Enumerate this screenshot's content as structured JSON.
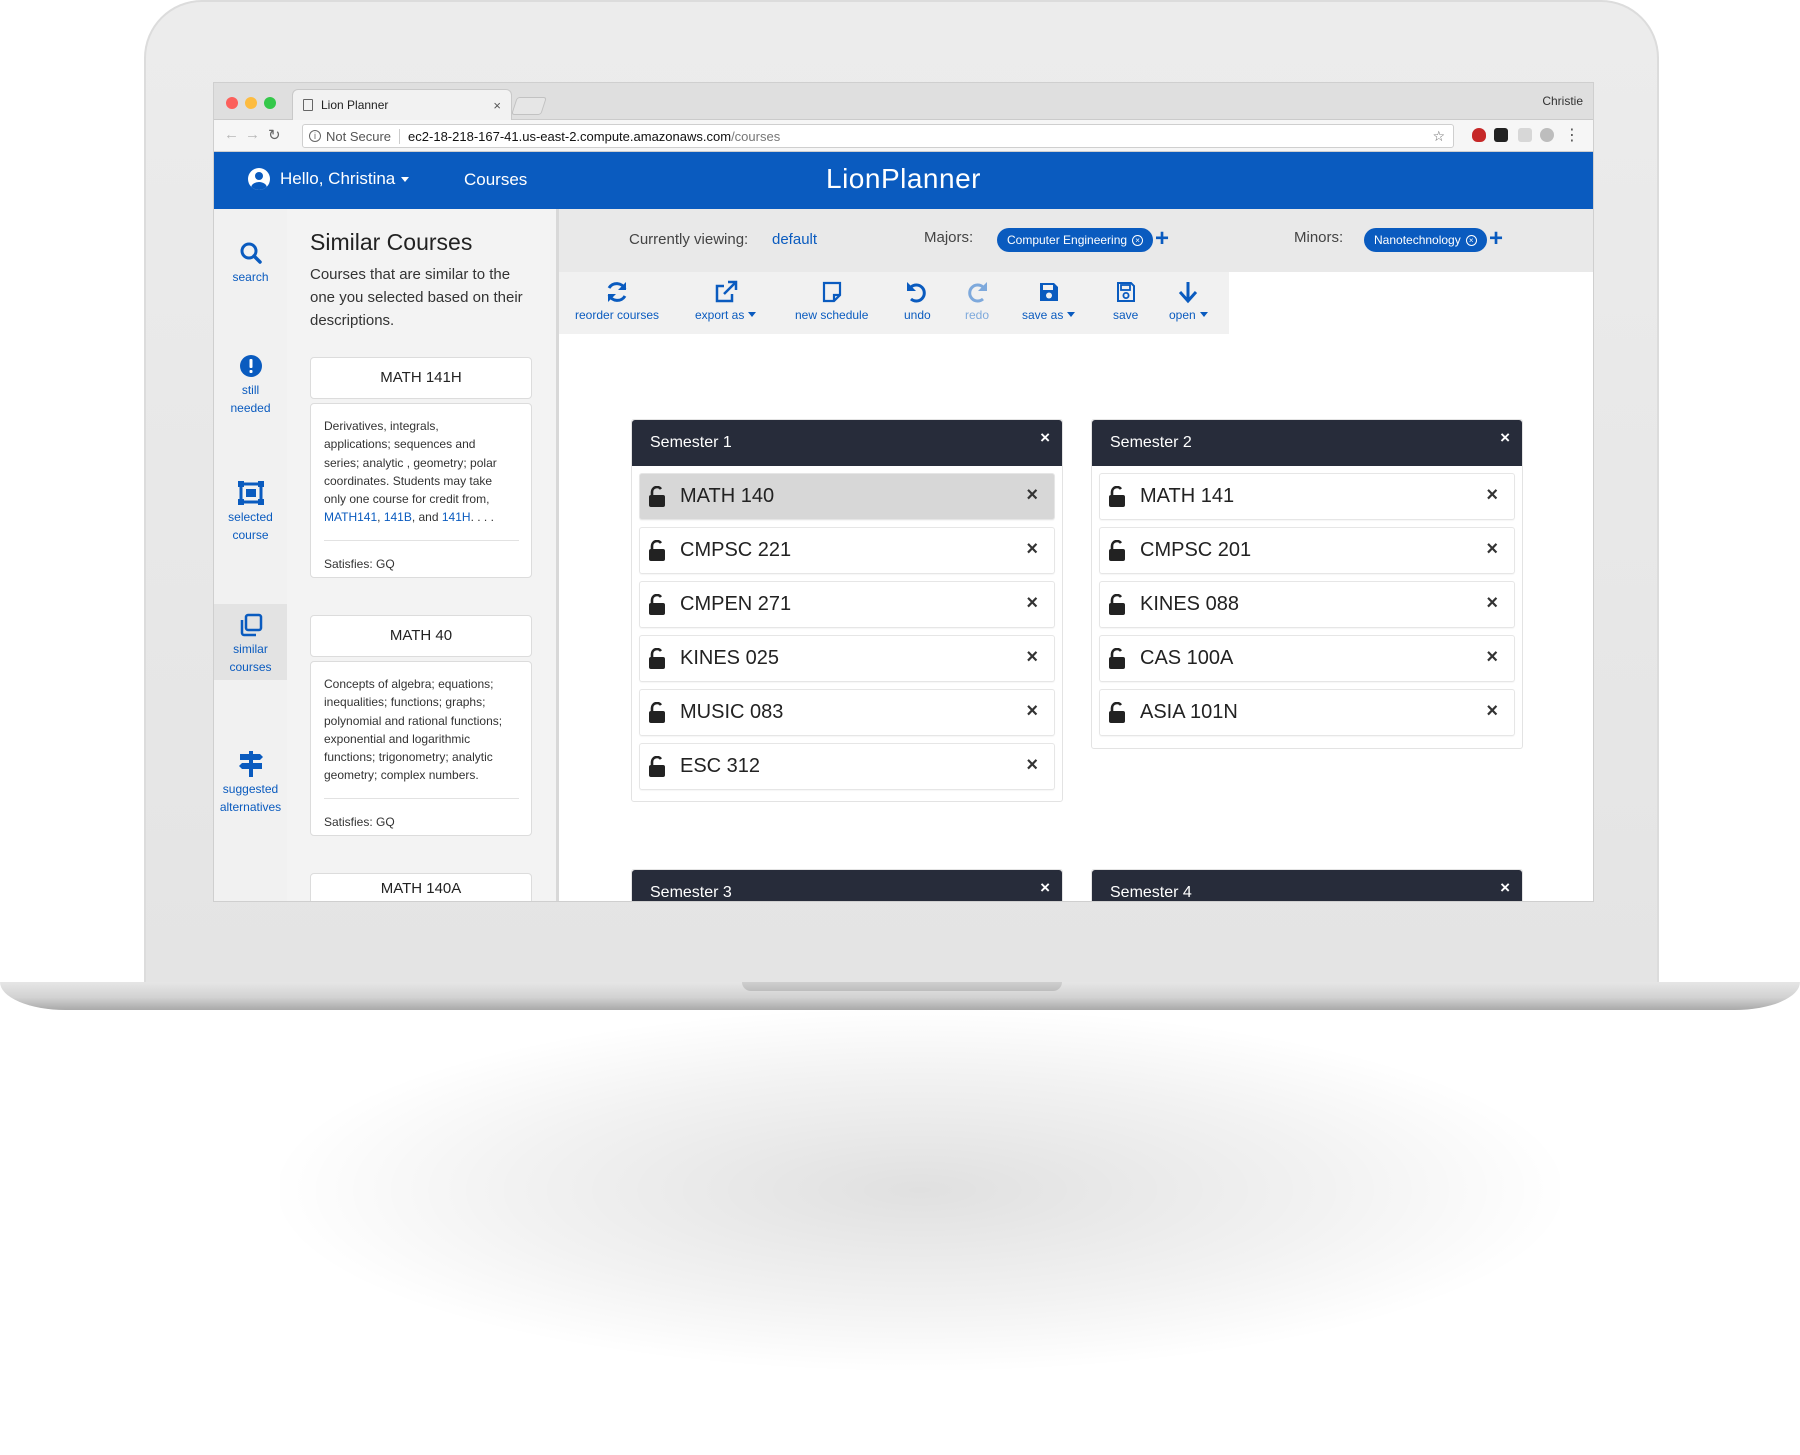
{
  "browser": {
    "tab_title": "Lion Planner",
    "tab_close": "×",
    "profile_name": "Christie",
    "security_label": "Not Secure",
    "url_host": "ec2-18-218-167-41.us-east-2.compute.amazonaws.com",
    "url_path": "/courses",
    "icons": [
      "back-arrow-icon",
      "forward-arrow-icon",
      "reload-icon",
      "info-icon",
      "star-icon",
      "menu-dots-icon"
    ]
  },
  "header": {
    "greeting": "Hello, Christina",
    "nav_courses": "Courses",
    "app_title": "LionPlanner",
    "brand_color": "#0a5bbf"
  },
  "rail": {
    "items": [
      {
        "label_line1": "search",
        "label_line2": "",
        "icon": "search-icon"
      },
      {
        "label_line1": "still",
        "label_line2": "needed",
        "icon": "exclamation-circle-icon"
      },
      {
        "label_line1": "selected",
        "label_line2": "course",
        "icon": "selected-course-icon"
      },
      {
        "label_line1": "similar",
        "label_line2": "courses",
        "icon": "copy-icon",
        "active": true
      },
      {
        "label_line1": "suggested",
        "label_line2": "alternatives",
        "icon": "signpost-icon"
      }
    ]
  },
  "similar_panel": {
    "title": "Similar Courses",
    "description": "Courses that are similar to the one you selected based on their descriptions.",
    "cards": [
      {
        "code": "MATH 141H",
        "desc_line1": "Derivatives, integrals,",
        "desc_line2": "applications; sequences and",
        "desc_line3": "series; analytic , geometry; polar",
        "desc_line4": "coordinates. Students may take",
        "desc_line5": "only one course for credit from,",
        "link1": "MATH141",
        "sep1": ", ",
        "link2": "141B",
        "sep2": ", and ",
        "link3": "141H",
        "ellipsis": ". . . .",
        "satisfies": "Satisfies:  GQ"
      },
      {
        "code": "MATH 40",
        "desc_line1": "Concepts of algebra; equations;",
        "desc_line2": "inequalities; functions; graphs;",
        "desc_line3": "polynomial and rational functions;",
        "desc_line4": "exponential and logarithmic",
        "desc_line5": "functions; trigonometry; analytic",
        "desc_line6": "geometry; complex numbers.",
        "satisfies": "Satisfies:  GQ"
      },
      {
        "code": "MATH 140A"
      }
    ]
  },
  "viewbar": {
    "viewing_label": "Currently viewing:",
    "viewing_value": "default",
    "majors_label": "Majors:",
    "major": "Computer Engineering",
    "minors_label": "Minors:",
    "minor": "Nanotechnology",
    "add_symbol": "+",
    "remove_symbol": "×"
  },
  "toolbar": {
    "reorder": "reorder courses",
    "export": "export as",
    "new_schedule": "new schedule",
    "undo": "undo",
    "redo": "redo",
    "save_as": "save as",
    "save": "save",
    "open": "open"
  },
  "semesters": [
    {
      "name": "Semester 1",
      "courses": [
        "MATH 140",
        "CMPSC 221",
        "CMPEN 271",
        "KINES 025",
        "MUSIC 083",
        "ESC 312"
      ]
    },
    {
      "name": "Semester 2",
      "courses": [
        "MATH 141",
        "CMPSC 201",
        "KINES 088",
        "CAS 100A",
        "ASIA 101N"
      ]
    },
    {
      "name": "Semester 3",
      "courses": []
    },
    {
      "name": "Semester 4",
      "courses": []
    }
  ],
  "close_symbol": "×"
}
